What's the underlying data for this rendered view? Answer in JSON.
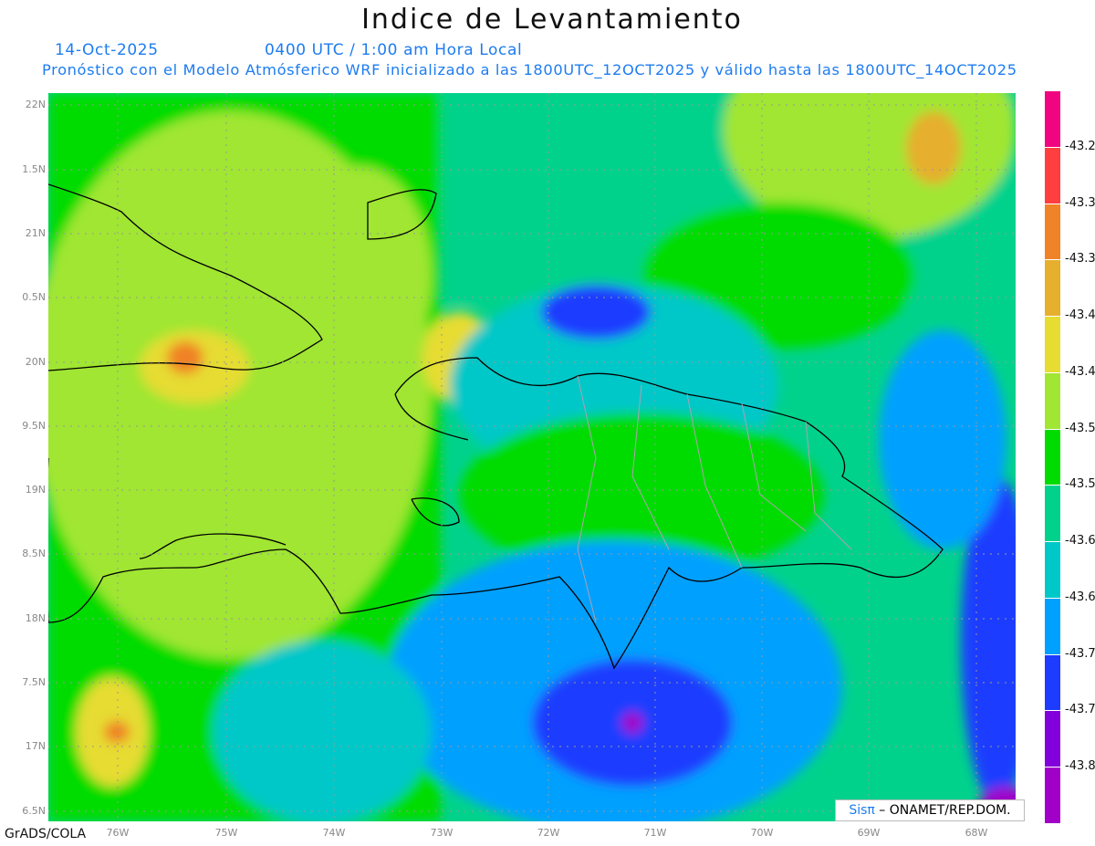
{
  "header": {
    "title": "Indice de Levantamiento",
    "date": "14-Oct-2025",
    "time": "0400 UTC / 1:00 am Hora Local",
    "description": "Pronóstico con el Modelo Atmósferico WRF inicializado a las 1800UTC_12OCT2025 y válido hasta las  1800UTC_14OCT2025"
  },
  "map": {
    "lat_labels": [
      "22N",
      "1.5N",
      "21N",
      "0.5N",
      "20N",
      "9.5N",
      "19N",
      "8.5N",
      "18N",
      "7.5N",
      "17N",
      "6.5N"
    ],
    "lon_labels": [
      "76W",
      "75W",
      "74W",
      "73W",
      "72W",
      "71W",
      "70W",
      "69W",
      "68W"
    ]
  },
  "colorbar": {
    "colors": [
      "#f0047f",
      "#ff3f3f",
      "#f08228",
      "#e6af2d",
      "#e6dc32",
      "#a0e632",
      "#00dc00",
      "#00d28c",
      "#00c8c8",
      "#00a0ff",
      "#1e3cff",
      "#8200dc",
      "#a000c8"
    ],
    "labels": [
      "-43.2",
      "-43.3",
      "-43.3",
      "-43.4",
      "-43.4",
      "-43.5",
      "-43.5",
      "-43.6",
      "-43.6",
      "-43.7",
      "-43.7",
      "-43.8"
    ]
  },
  "credit": {
    "logo": "Sisπ",
    "text": " – ONAMET/REP.DOM."
  },
  "footer": {
    "software": "GrADS/COLA"
  }
}
